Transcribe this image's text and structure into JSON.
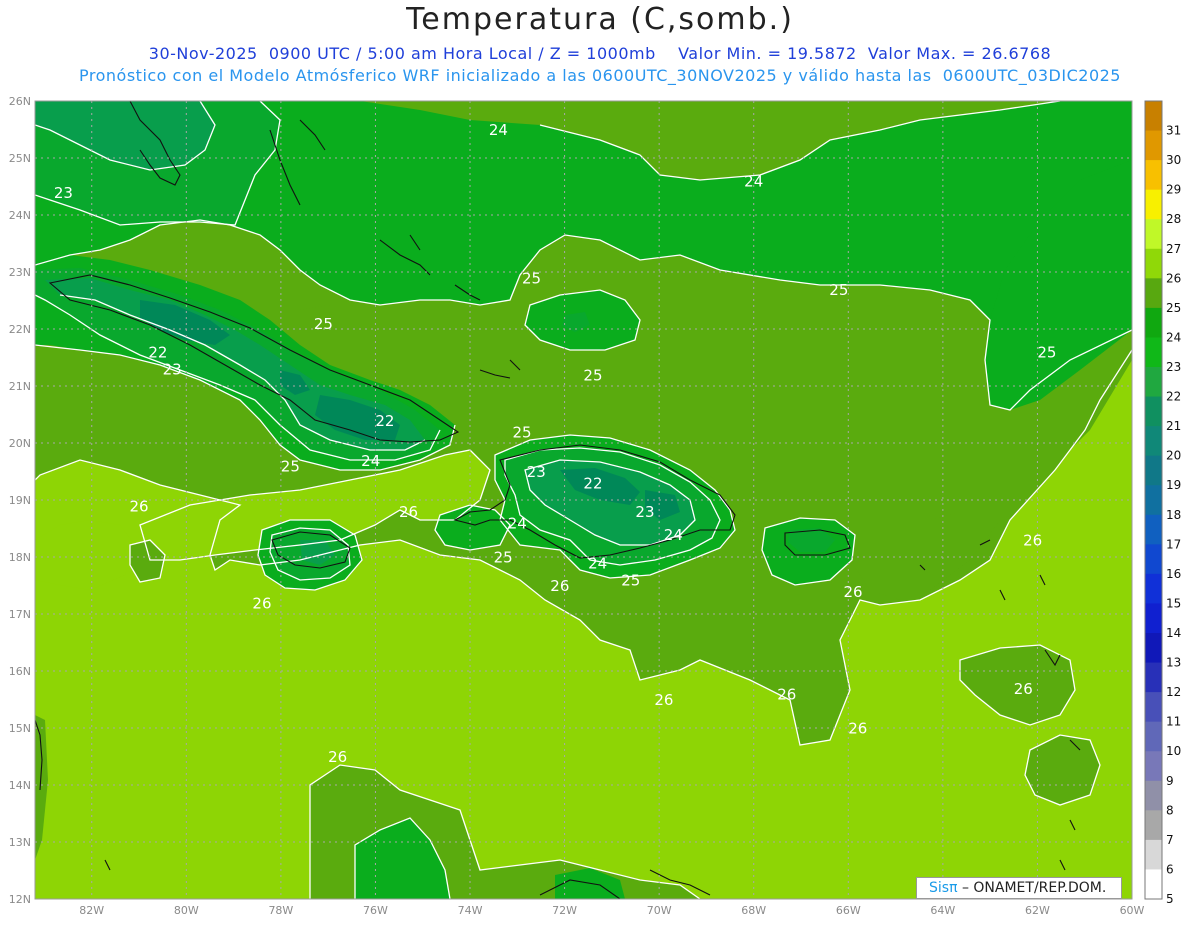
{
  "header": {
    "title": "Temperatura (C,somb.)",
    "line1": "30-Nov-2025  0900 UTC / 5:00 am Hora Local / Z = 1000mb    Valor Min. = 19.5872  Valor Max. = 26.6768",
    "line2": "Pronóstico con el Modelo Atmósferico WRF inicializado a las 0600UTC_30NOV2025 y válido hasta las  0600UTC_03DIC2025"
  },
  "map": {
    "lon_range": [
      -83.2,
      -60
    ],
    "lat_range": [
      12,
      26
    ],
    "lat_ticks": [
      "26N",
      "25N",
      "24N",
      "23N",
      "22N",
      "21N",
      "20N",
      "19N",
      "18N",
      "17N",
      "16N",
      "15N",
      "14N",
      "13N",
      "12N"
    ],
    "lon_ticks": [
      "82W",
      "80W",
      "78W",
      "76W",
      "74W",
      "72W",
      "70W",
      "68W",
      "66W",
      "64W",
      "62W",
      "60W"
    ],
    "colors": {
      "t21": "#008858",
      "t22": "#089e4c",
      "t23": "#09a82d",
      "t24": "#0aad1d",
      "t25": "#5aab0e",
      "t26": "#8ed505",
      "contour": "#ffffff",
      "coast": "#111111",
      "grid": "#a8a8a8"
    },
    "contour_labels": [
      {
        "text": "24",
        "lon": -73.4,
        "lat": 25.4
      },
      {
        "text": "24",
        "lon": -68.0,
        "lat": 24.5
      },
      {
        "text": "23",
        "lon": -82.6,
        "lat": 24.3
      },
      {
        "text": "25",
        "lon": -72.7,
        "lat": 22.8
      },
      {
        "text": "25",
        "lon": -66.2,
        "lat": 22.6
      },
      {
        "text": "25",
        "lon": -61.8,
        "lat": 21.5
      },
      {
        "text": "25",
        "lon": -77.1,
        "lat": 22.0
      },
      {
        "text": "22",
        "lon": -80.6,
        "lat": 21.5
      },
      {
        "text": "23",
        "lon": -80.3,
        "lat": 21.2
      },
      {
        "text": "25",
        "lon": -71.4,
        "lat": 21.1
      },
      {
        "text": "22",
        "lon": -75.8,
        "lat": 20.3
      },
      {
        "text": "25",
        "lon": -72.9,
        "lat": 20.1
      },
      {
        "text": "24",
        "lon": -76.1,
        "lat": 19.6
      },
      {
        "text": "25",
        "lon": -77.8,
        "lat": 19.5
      },
      {
        "text": "23",
        "lon": -72.6,
        "lat": 19.4
      },
      {
        "text": "22",
        "lon": -71.4,
        "lat": 19.2
      },
      {
        "text": "23",
        "lon": -70.3,
        "lat": 18.7
      },
      {
        "text": "24",
        "lon": -73.0,
        "lat": 18.5
      },
      {
        "text": "24",
        "lon": -69.7,
        "lat": 18.3
      },
      {
        "text": "26",
        "lon": -75.3,
        "lat": 18.7
      },
      {
        "text": "26",
        "lon": -81.0,
        "lat": 18.8
      },
      {
        "text": "25",
        "lon": -73.3,
        "lat": 17.9
      },
      {
        "text": "24",
        "lon": -71.3,
        "lat": 17.8
      },
      {
        "text": "26",
        "lon": -72.1,
        "lat": 17.4
      },
      {
        "text": "25",
        "lon": -70.6,
        "lat": 17.5
      },
      {
        "text": "26",
        "lon": -65.9,
        "lat": 17.3
      },
      {
        "text": "26",
        "lon": -78.4,
        "lat": 17.1
      },
      {
        "text": "26",
        "lon": -62.1,
        "lat": 18.2
      },
      {
        "text": "26",
        "lon": -67.3,
        "lat": 15.5
      },
      {
        "text": "26",
        "lon": -69.9,
        "lat": 15.4
      },
      {
        "text": "26",
        "lon": -65.8,
        "lat": 14.9
      },
      {
        "text": "26",
        "lon": -62.3,
        "lat": 15.6
      },
      {
        "text": "26",
        "lon": -76.8,
        "lat": 14.4
      }
    ]
  },
  "colorbar": {
    "labels": [
      "31",
      "30",
      "29",
      "28",
      "27",
      "26",
      "25",
      "24",
      "23",
      "22",
      "21",
      "20",
      "19",
      "18",
      "17",
      "16",
      "15",
      "14",
      "13",
      "12",
      "11",
      "10",
      "9",
      "8",
      "7",
      "6",
      "5"
    ],
    "colors": [
      "#c88000",
      "#e09800",
      "#f8c000",
      "#f8f000",
      "#c0f828",
      "#90d808",
      "#58a810",
      "#10a810",
      "#10b818",
      "#20a840",
      "#109060",
      "#108878",
      "#107888",
      "#1070a0",
      "#1060c0",
      "#1048d0",
      "#1030d8",
      "#1020d0",
      "#1018b8",
      "#2830b8",
      "#4850b8",
      "#6068b8",
      "#7878b8",
      "#9090a8",
      "#a8a8a8",
      "#d8d8d8",
      "#ffffff"
    ]
  },
  "credit": {
    "sis": "Sisπ",
    "rest": " – ONAMET/REP.DOM."
  }
}
